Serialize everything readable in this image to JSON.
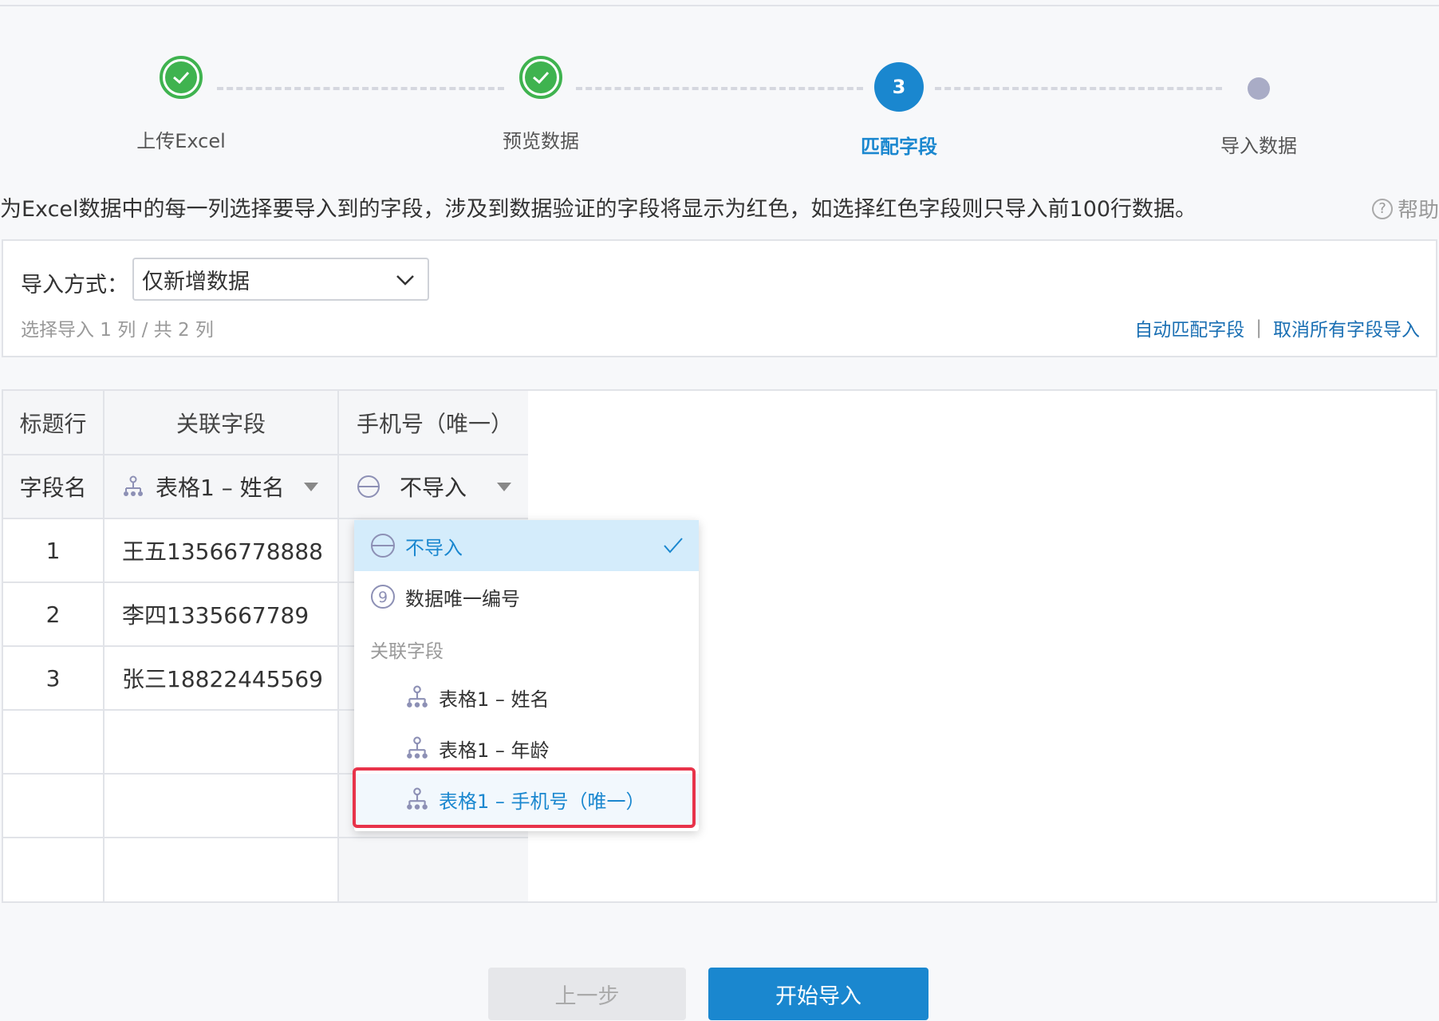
{
  "steps": [
    {
      "label": "上传Excel",
      "state": "done"
    },
    {
      "label": "预览数据",
      "state": "done"
    },
    {
      "label": "匹配字段",
      "state": "active",
      "number": "3"
    },
    {
      "label": "导入数据",
      "state": "pending"
    }
  ],
  "instruction": "为Excel数据中的每一列选择要导入到的字段，涉及到数据验证的字段将显示为红色，如选择红色字段则只导入前100行数据。",
  "help_label": "帮助",
  "import_mode": {
    "label": "导入方式：",
    "value": "仅新增数据"
  },
  "column_count": "选择导入 1 列 / 共 2 列",
  "links": {
    "auto_match": "自动匹配字段",
    "separator": "|",
    "cancel_all": "取消所有字段导入"
  },
  "table": {
    "header_row_label": "标题行",
    "field_row_label": "字段名",
    "columns": [
      {
        "title": "关联字段",
        "field": "表格1 – 姓名"
      },
      {
        "title": "手机号（唯一）",
        "field": "不导入"
      }
    ],
    "rows": [
      {
        "index": "1",
        "value": "王五13566778888"
      },
      {
        "index": "2",
        "value": "李四1335667789"
      },
      {
        "index": "3",
        "value": "张三18822445569"
      }
    ]
  },
  "dropdown": {
    "items": [
      {
        "label": "不导入",
        "selected": true
      },
      {
        "label": "数据唯一编号"
      }
    ],
    "group_label": "关联字段",
    "group_items": [
      {
        "label": "表格1 – 姓名"
      },
      {
        "label": "表格1 – 年龄"
      },
      {
        "label": "表格1 – 手机号（唯一）",
        "highlighted": true
      }
    ]
  },
  "buttons": {
    "prev": "上一步",
    "start": "开始导入"
  },
  "colors": {
    "accent": "#1a87cf",
    "done": "#3fb34f",
    "highlight": "#e8334a"
  }
}
